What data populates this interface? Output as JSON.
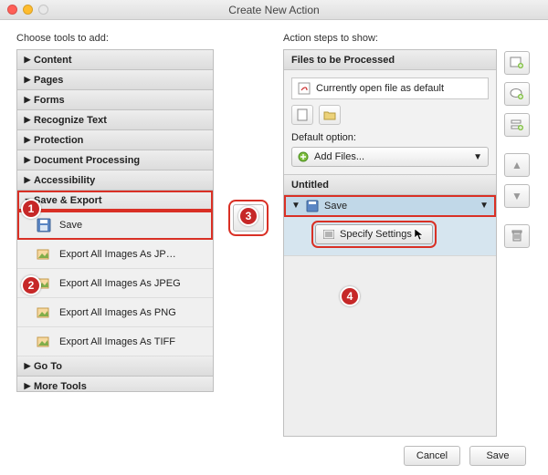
{
  "window": {
    "title": "Create New Action"
  },
  "left": {
    "label": "Choose tools to add:",
    "categories": [
      {
        "name": "Content",
        "expanded": false
      },
      {
        "name": "Pages",
        "expanded": false
      },
      {
        "name": "Forms",
        "expanded": false
      },
      {
        "name": "Recognize Text",
        "expanded": false
      },
      {
        "name": "Protection",
        "expanded": false
      },
      {
        "name": "Document Processing",
        "expanded": false
      },
      {
        "name": "Accessibility",
        "expanded": false
      },
      {
        "name": "Save & Export",
        "expanded": true,
        "highlight": true
      },
      {
        "name": "Go To",
        "expanded": false
      },
      {
        "name": "More Tools",
        "expanded": false
      }
    ],
    "export_tools": [
      {
        "label": "Save",
        "selected": true
      },
      {
        "label": "Export All Images As JP…"
      },
      {
        "label": "Export All Images As JPEG"
      },
      {
        "label": "Export All Images As PNG"
      },
      {
        "label": "Export All Images As TIFF"
      }
    ]
  },
  "right": {
    "label": "Action steps to show:",
    "files_header": "Files to be Processed",
    "open_file_label": "Currently open file as default",
    "default_option_label": "Default option:",
    "dropdown_label": "Add Files...",
    "untitled_header": "Untitled",
    "save_step_label": "Save",
    "specify_settings": "Specify Settings"
  },
  "buttons": {
    "cancel": "Cancel",
    "save": "Save"
  },
  "badges": {
    "b1": "1",
    "b2": "2",
    "b3": "3",
    "b4": "4"
  }
}
